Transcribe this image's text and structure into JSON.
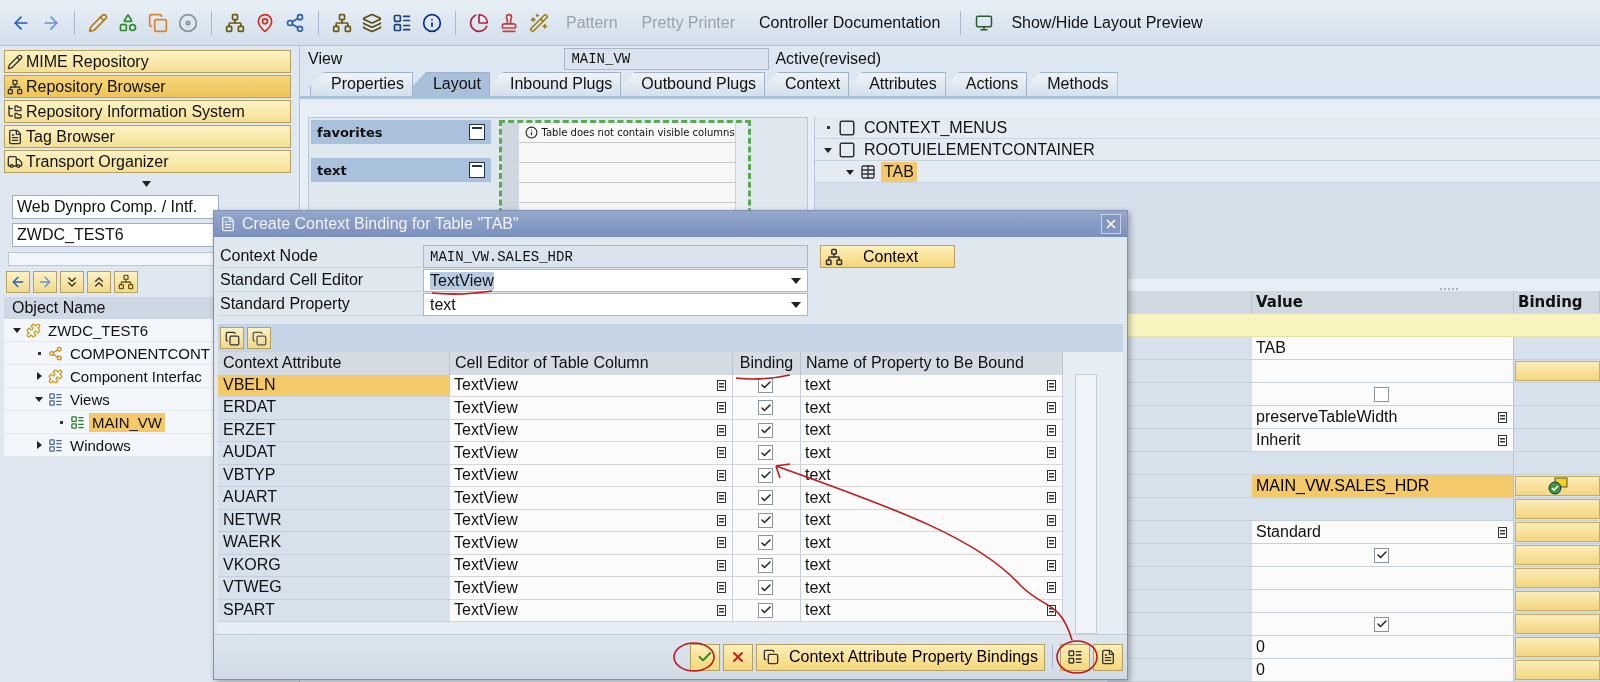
{
  "toolbar": {
    "buttons": [
      {
        "label": "Pattern",
        "disabled": true
      },
      {
        "label": "Pretty Printer",
        "disabled": true
      },
      {
        "label": "Controller Documentation",
        "disabled": false
      },
      {
        "label": "Show/Hide Layout Preview",
        "disabled": false
      }
    ]
  },
  "nav_buttons": [
    {
      "label": "MIME Repository",
      "selected": false
    },
    {
      "label": "Repository Browser",
      "selected": true
    },
    {
      "label": "Repository Information System",
      "selected": false
    },
    {
      "label": "Tag Browser",
      "selected": false
    },
    {
      "label": "Transport Organizer",
      "selected": false
    }
  ],
  "object_selector": {
    "type_value": "Web Dynpro Comp. / Intf.",
    "name_value": "ZWDC_TEST6"
  },
  "object_tree": {
    "header": "Object Name",
    "items": [
      {
        "label": "ZWDC_TEST6",
        "expanded": true,
        "selected": false,
        "children": [
          {
            "label": "COMPONENTCONT",
            "selected": false
          },
          {
            "label": "Component Interfac",
            "expanded": false,
            "selected": false
          },
          {
            "label": "Views",
            "expanded": true,
            "selected": false,
            "children": [
              {
                "label": "MAIN_VW",
                "selected": true
              }
            ]
          },
          {
            "label": "Windows",
            "expanded": false,
            "selected": false
          }
        ]
      }
    ]
  },
  "view_header": {
    "label": "View",
    "name": "MAIN_VW",
    "status": "Active(revised)"
  },
  "tabs": [
    {
      "label": "Properties",
      "selected": false
    },
    {
      "label": "Layout",
      "selected": true
    },
    {
      "label": "Inbound Plugs",
      "selected": false
    },
    {
      "label": "Outbound Plugs",
      "selected": false
    },
    {
      "label": "Context",
      "selected": false
    },
    {
      "label": "Attributes",
      "selected": false
    },
    {
      "label": "Actions",
      "selected": false
    },
    {
      "label": "Methods",
      "selected": false
    }
  ],
  "layout_preview": {
    "groups": [
      {
        "label": "favorites"
      },
      {
        "label": "text"
      }
    ],
    "table_message": "Table does not contain visible columns"
  },
  "ui_tree": {
    "items": [
      {
        "label": "CONTEXT_MENUS",
        "selected": false
      },
      {
        "label": "ROOTUIELEMENTCONTAINER",
        "expanded": true,
        "selected": false,
        "children": [
          {
            "label": "TAB",
            "expanded": true,
            "selected": true
          }
        ]
      }
    ]
  },
  "properties": {
    "columns": [
      "Value",
      "Binding"
    ],
    "rows": [
      {
        "kind": "section"
      },
      {
        "kind": "text",
        "value": "TAB",
        "binding_button": false,
        "selected": false
      },
      {
        "kind": "text",
        "binding_button": true,
        "bound": false,
        "selected": false
      },
      {
        "kind": "checkbox",
        "checked": false,
        "binding_button": false,
        "selected": false
      },
      {
        "kind": "dropdown",
        "value": "preserveTableWidth",
        "binding_button": false,
        "selected": false
      },
      {
        "kind": "dropdown",
        "value": "Inherit",
        "binding_button": false,
        "selected": false
      },
      {
        "kind": "blank",
        "binding_button": false,
        "selected": false
      },
      {
        "kind": "text",
        "value": "MAIN_VW.SALES_HDR",
        "binding_button": true,
        "bound": true,
        "selected": true
      },
      {
        "kind": "blank",
        "binding_button": true,
        "bound": false,
        "selected": false
      },
      {
        "kind": "dropdown",
        "value": "Standard",
        "binding_button": true,
        "bound": false,
        "selected": false
      },
      {
        "kind": "checkbox",
        "checked": true,
        "binding_button": true,
        "bound": false,
        "selected": false
      },
      {
        "kind": "text",
        "binding_button": true,
        "bound": false,
        "selected": false
      },
      {
        "kind": "text",
        "binding_button": true,
        "bound": false,
        "selected": false
      },
      {
        "kind": "checkbox",
        "checked": true,
        "binding_button": true,
        "bound": false,
        "selected": false
      },
      {
        "kind": "text",
        "value": "0",
        "binding_button": true,
        "bound": false,
        "selected": false
      },
      {
        "kind": "text",
        "value": "0",
        "binding_button": true,
        "bound": false,
        "selected": false
      }
    ]
  },
  "dialog": {
    "title": "Create Context Binding for Table \"TAB\"",
    "fields": [
      {
        "label": "Context Node",
        "value": "MAIN_VW.SALES_HDR",
        "kind": "readonly"
      },
      {
        "label": "Standard Cell Editor",
        "value": "TextView",
        "kind": "dropdown"
      },
      {
        "label": "Standard Property",
        "value": "text",
        "kind": "dropdown"
      }
    ],
    "context_button": "Context",
    "columns": [
      "Context Attribute",
      "Cell Editor of Table Column",
      "Binding",
      "Name of Property to Be Bound"
    ],
    "rows": [
      {
        "attribute": "VBELN",
        "editor": "TextView",
        "binding": true,
        "property": "text",
        "selected": true
      },
      {
        "attribute": "ERDAT",
        "editor": "TextView",
        "binding": true,
        "property": "text",
        "selected": false
      },
      {
        "attribute": "ERZET",
        "editor": "TextView",
        "binding": true,
        "property": "text",
        "selected": false
      },
      {
        "attribute": "AUDAT",
        "editor": "TextView",
        "binding": true,
        "property": "text",
        "selected": false
      },
      {
        "attribute": "VBTYP",
        "editor": "TextView",
        "binding": true,
        "property": "text",
        "selected": false
      },
      {
        "attribute": "AUART",
        "editor": "TextView",
        "binding": true,
        "property": "text",
        "selected": false
      },
      {
        "attribute": "NETWR",
        "editor": "TextView",
        "binding": true,
        "property": "text",
        "selected": false
      },
      {
        "attribute": "WAERK",
        "editor": "TextView",
        "binding": true,
        "property": "text",
        "selected": false
      },
      {
        "attribute": "VKORG",
        "editor": "TextView",
        "binding": true,
        "property": "text",
        "selected": false
      },
      {
        "attribute": "VTWEG",
        "editor": "TextView",
        "binding": true,
        "property": "text",
        "selected": false
      },
      {
        "attribute": "SPART",
        "editor": "TextView",
        "binding": true,
        "property": "text",
        "selected": false
      }
    ],
    "footer_button": "Context Attribute Property Bindings"
  }
}
